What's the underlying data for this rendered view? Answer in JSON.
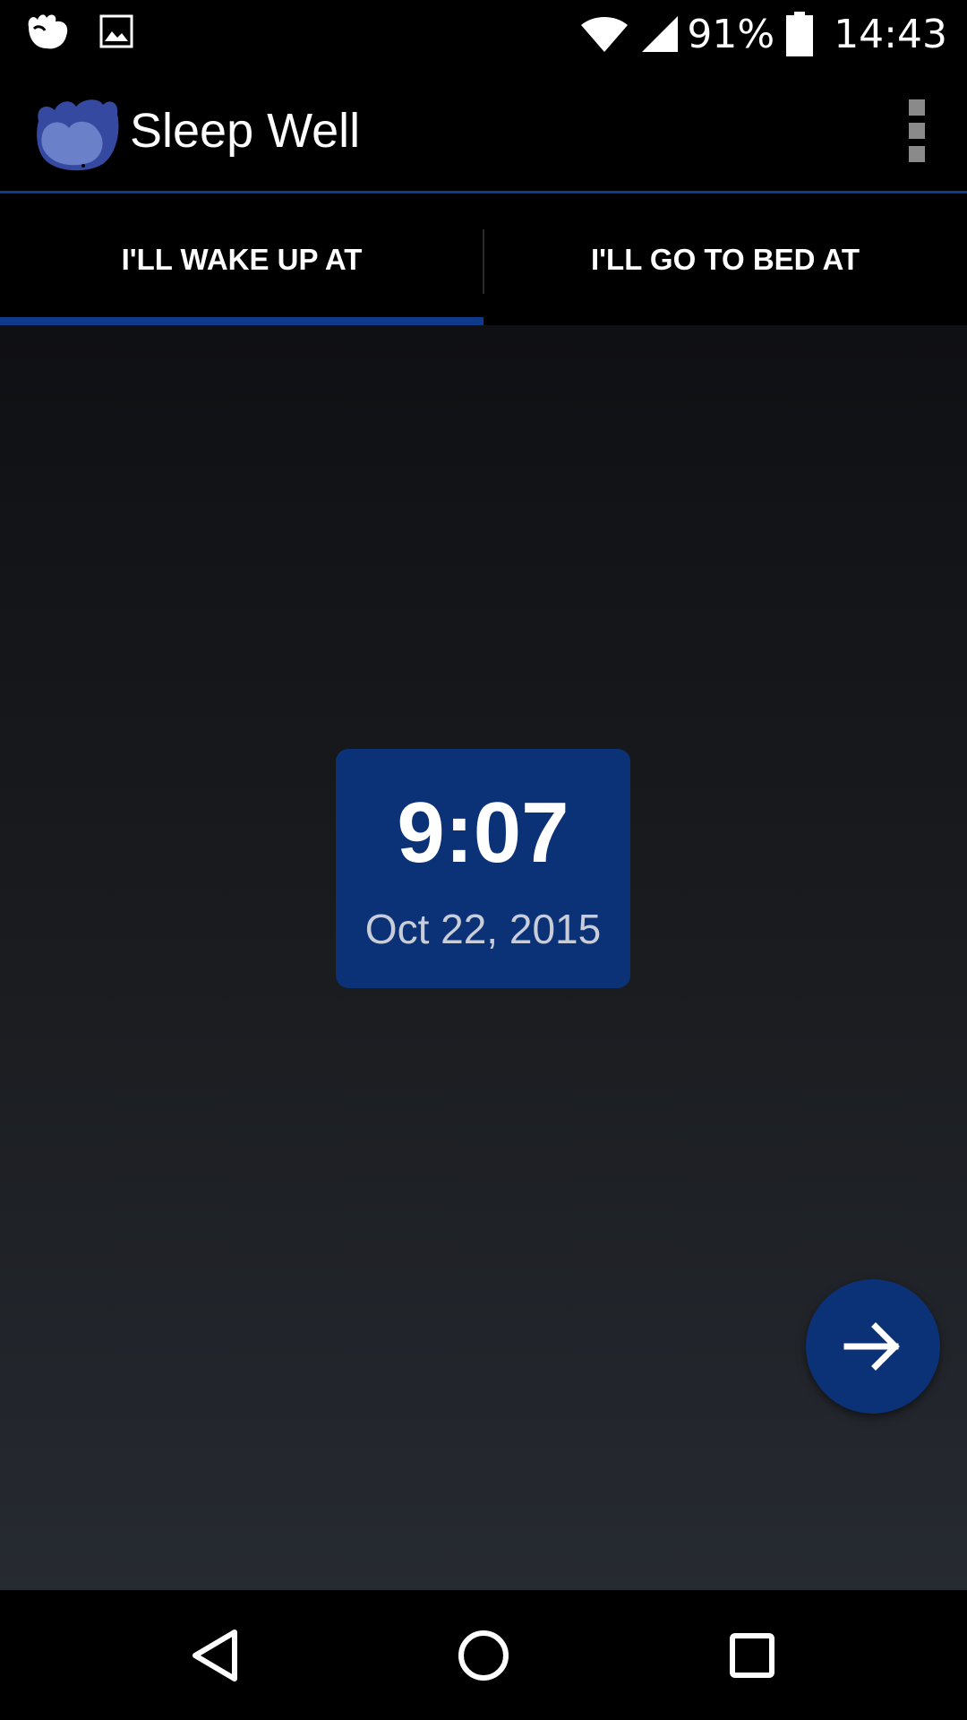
{
  "status_bar": {
    "left_icons": [
      "app-notification-icon",
      "image-icon"
    ],
    "right_icons": [
      "wifi-icon",
      "cell-signal-icon",
      "battery-icon"
    ],
    "battery_percent": "91%",
    "time": "14:43"
  },
  "app_bar": {
    "title": "Sleep Well",
    "logo": "sleep-well-logo",
    "menu_icon": "overflow-menu-icon"
  },
  "tabs": [
    {
      "label": "I'LL WAKE UP AT",
      "selected": true
    },
    {
      "label": "I'LL GO TO BED AT",
      "selected": false
    }
  ],
  "time_picker": {
    "time": "9:07",
    "date": "Oct 22, 2015"
  },
  "fab": {
    "icon": "arrow-right-icon"
  },
  "nav_bar": {
    "icons": [
      "back-icon",
      "home-icon",
      "recents-icon"
    ]
  },
  "colors": {
    "accent": "#0b3277",
    "tab_indicator": "#0d3a8a"
  }
}
